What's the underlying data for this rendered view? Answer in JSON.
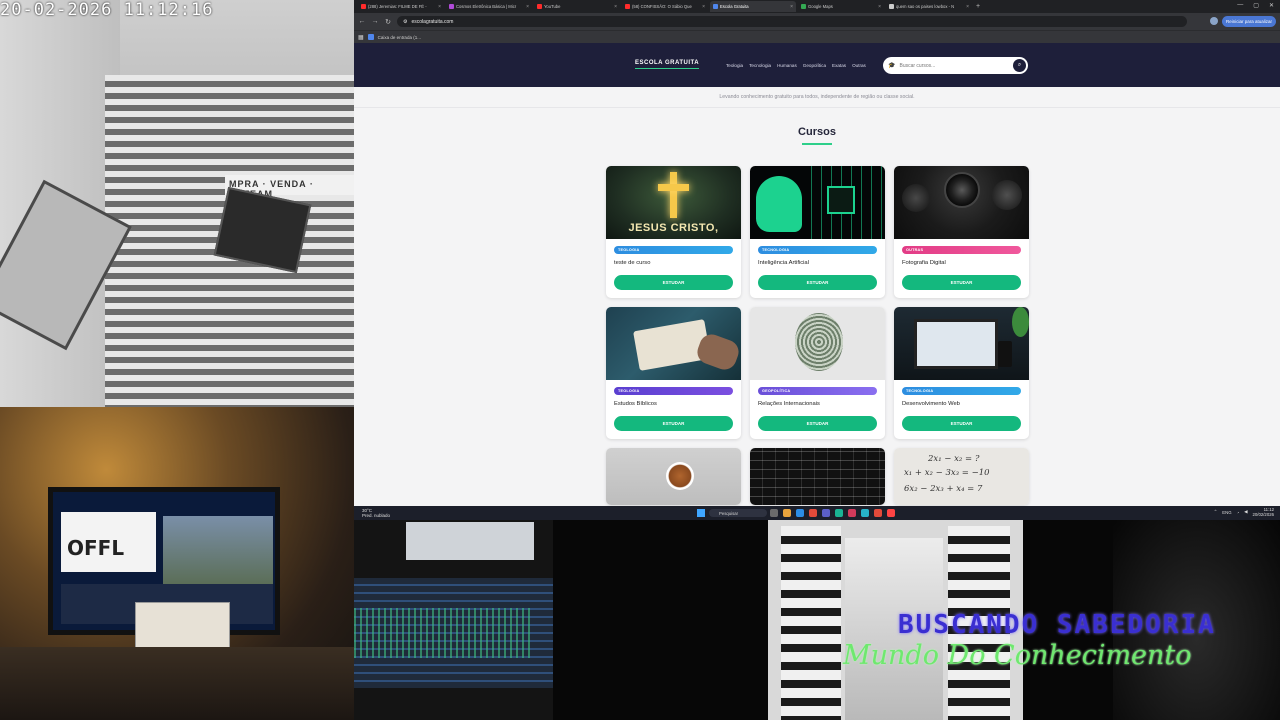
{
  "camera": {
    "timestamp": "20-02-2026 11:12:16",
    "storefront_sign": "MPRA · VENDA · LOTEAM",
    "monitor_text": "OFFL"
  },
  "overlay": {
    "title": "BUSCANDO SABEDORIA",
    "subtitle": "Mundo Do Conhecimento"
  },
  "browser": {
    "tabs": [
      {
        "label": "(288) Jeremias: FILME DE FÉ -",
        "color": "#ff2b2b",
        "active": false
      },
      {
        "label": "Cosmos Eletrônica Básica | Micr",
        "color": "#b04bd8",
        "active": false
      },
      {
        "label": "YouTube",
        "color": "#ff2b2b",
        "active": false
      },
      {
        "label": "(58) CONFISSÃO: O Sábio Que",
        "color": "#ff2b2b",
        "active": false
      },
      {
        "label": "Escola Gratuita",
        "color": "#4f86ec",
        "active": true
      },
      {
        "label": "Google Maps",
        "color": "#34a853",
        "active": false
      },
      {
        "label": "quem sao os paises lowbox - N",
        "color": "#cccccc",
        "active": false
      }
    ],
    "url": "escolagratuita.com",
    "update_label": "Reiniciar para atualizar",
    "bookmark_label": "Caixa de entrada (1..."
  },
  "site": {
    "logo": "ESCOLA GRATUITA",
    "nav": [
      "Teologia",
      "Tecnologia",
      "Humanas",
      "Geopolítica",
      "Exatas",
      "Outras"
    ],
    "search_placeholder": "Buscar cursos...",
    "tagline": "Levando conhecimento gratuito para todos, independente de região ou classe social.",
    "section_title": "Cursos",
    "study_label": "ESTUDAR",
    "image_text": "JESUS CRISTO,",
    "courses": [
      {
        "category": "TEOLOGIA",
        "title": "teste de curso",
        "category_color": "#2d8de0"
      },
      {
        "category": "TECNOLOGIA",
        "title": "Inteligência Artificial",
        "category_color": "#2d8de0"
      },
      {
        "category": "OUTRAS",
        "title": "Fotografia Digital",
        "category_color": "#e23c86"
      },
      {
        "category": "TEOLOGIA",
        "title": "Estudos Bíblicos",
        "category_color": "#5a3fd0"
      },
      {
        "category": "GEOPOLÍTICA",
        "title": "Relações Internacionais",
        "category_color": "#6a4fd8"
      },
      {
        "category": "TECNOLOGIA",
        "title": "Desenvolvimento Web",
        "category_color": "#2d8de0"
      }
    ],
    "equations": [
      "2x₁ − x₂ = ?",
      "x₁ + x₂ − 3x₃ = −10",
      "6x₂ − 2x₃ + x₄ = 7"
    ]
  },
  "taskbar": {
    "weather_temp": "30°C",
    "weather_desc": "Pred. nublado",
    "search_label": "Pesquisar",
    "lang": "ENG",
    "time": "11:12",
    "date": "20/02/2026"
  }
}
